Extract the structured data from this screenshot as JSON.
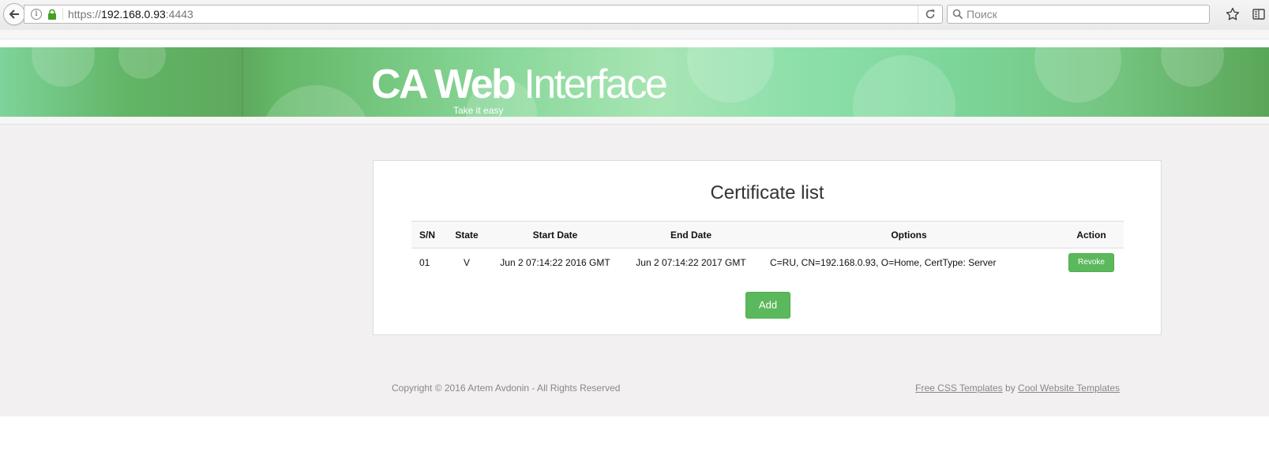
{
  "browser": {
    "url_scheme": "https://",
    "url_host": "192.168.0.93",
    "url_port": ":4443",
    "search_placeholder": "Поиск"
  },
  "header": {
    "title_bold": "CA Web",
    "title_light": "Interface",
    "tagline": "Take it easy"
  },
  "main": {
    "heading": "Certificate list",
    "table": {
      "columns": [
        "S/N",
        "State",
        "Start Date",
        "End Date",
        "Options",
        "Action"
      ],
      "rows": [
        {
          "sn": "01",
          "state": "V",
          "start": "Jun 2 07:14:22 2016 GMT",
          "end": "Jun 2 07:14:22 2017 GMT",
          "options": "C=RU, CN=192.168.0.93, O=Home, CertType: Server",
          "action": "Revoke"
        }
      ]
    },
    "add_label": "Add"
  },
  "footer": {
    "copyright": "Copyright © 2016 Artem Avdonin - All Rights Reserved",
    "link1": "Free CSS Templates",
    "by": "by",
    "link2": "Cool Website Templates"
  },
  "colors": {
    "accent_button": "#5cb85c",
    "banner_green": "#7fd69b",
    "content_bg": "#f2f0f0"
  }
}
